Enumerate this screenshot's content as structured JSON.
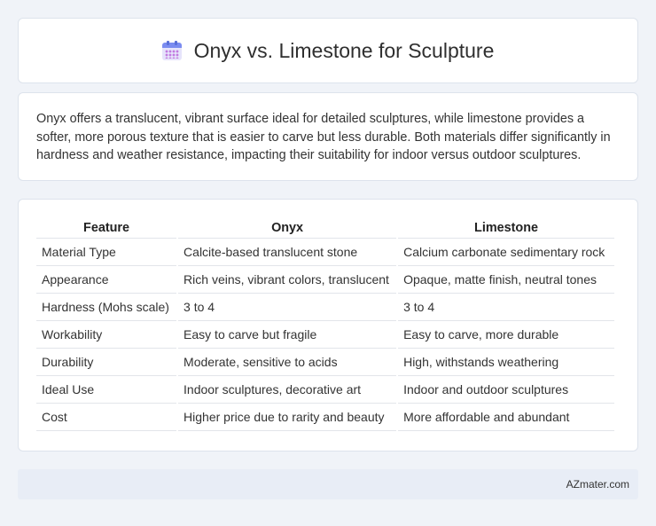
{
  "header": {
    "icon": "calendar-icon",
    "title": "Onyx vs. Limestone for Sculpture"
  },
  "description": "Onyx offers a translucent, vibrant surface ideal for detailed sculptures, while limestone provides a softer, more porous texture that is easier to carve but less durable. Both materials differ significantly in hardness and weather resistance, impacting their suitability for indoor versus outdoor sculptures.",
  "table": {
    "headers": [
      "Feature",
      "Onyx",
      "Limestone"
    ],
    "rows": [
      [
        "Material Type",
        "Calcite-based translucent stone",
        "Calcium carbonate sedimentary rock"
      ],
      [
        "Appearance",
        "Rich veins, vibrant colors, translucent",
        "Opaque, matte finish, neutral tones"
      ],
      [
        "Hardness (Mohs scale)",
        "3 to 4",
        "3 to 4"
      ],
      [
        "Workability",
        "Easy to carve but fragile",
        "Easy to carve, more durable"
      ],
      [
        "Durability",
        "Moderate, sensitive to acids",
        "High, withstands weathering"
      ],
      [
        "Ideal Use",
        "Indoor sculptures, decorative art",
        "Indoor and outdoor sculptures"
      ],
      [
        "Cost",
        "Higher price due to rarity and beauty",
        "More affordable and abundant"
      ]
    ]
  },
  "footer": {
    "source": "AZmater.com"
  }
}
